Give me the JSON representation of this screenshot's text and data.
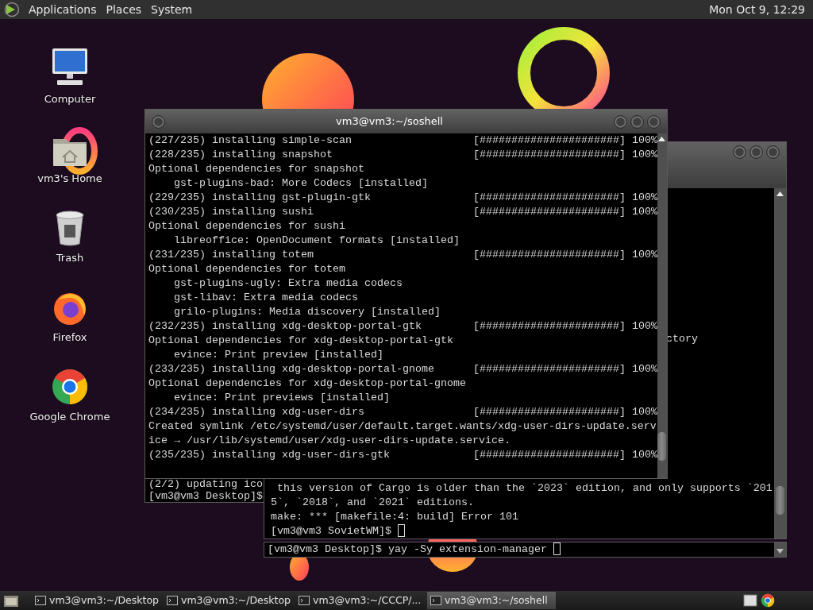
{
  "top_panel": {
    "menus": [
      {
        "label": "Applications"
      },
      {
        "label": "Places"
      },
      {
        "label": "System"
      }
    ],
    "clock": "Mon Oct 9, 12:29"
  },
  "desktop_icons": [
    {
      "kind": "computer",
      "label": "Computer"
    },
    {
      "kind": "home",
      "label": "vm3's Home"
    },
    {
      "kind": "trash",
      "label": "Trash"
    },
    {
      "kind": "firefox",
      "label": "Firefox"
    },
    {
      "kind": "chrome",
      "label": "Google Chrome"
    }
  ],
  "windows": [
    {
      "kind": "front_terminal",
      "title": "vm3@vm3:~/soshell",
      "lines": [
        {
          "text": "(227/235) installing simple-scan",
          "progress": "[######################] 100%"
        },
        {
          "text": "(228/235) installing snapshot",
          "progress": "[######################] 100%"
        },
        {
          "text": "Optional dependencies for snapshot"
        },
        {
          "text": "    gst-plugins-bad: More Codecs [installed]"
        },
        {
          "text": "(229/235) installing gst-plugin-gtk",
          "progress": "[######################] 100%"
        },
        {
          "text": "(230/235) installing sushi",
          "progress": "[######################] 100%"
        },
        {
          "text": "Optional dependencies for sushi"
        },
        {
          "text": "    libreoffice: OpenDocument formats [installed]"
        },
        {
          "text": "(231/235) installing totem",
          "progress": "[######################] 100%"
        },
        {
          "text": "Optional dependencies for totem"
        },
        {
          "text": "    gst-plugins-ugly: Extra media codecs"
        },
        {
          "text": "    gst-libav: Extra media codecs"
        },
        {
          "text": "    grilo-plugins: Media discovery [installed]"
        },
        {
          "text": "(232/235) installing xdg-desktop-portal-gtk",
          "progress": "[######################] 100%"
        },
        {
          "text": "Optional dependencies for xdg-desktop-portal-gtk"
        },
        {
          "text": "    evince: Print preview [installed]"
        },
        {
          "text": "(233/235) installing xdg-desktop-portal-gnome",
          "progress": "[######################] 100%"
        },
        {
          "text": "Optional dependencies for xdg-desktop-portal-gnome"
        },
        {
          "text": "    evince: Print previews [installed]"
        },
        {
          "text": "(234/235) installing xdg-user-dirs",
          "progress": "[######################] 100%"
        },
        {
          "text": "Created symlink /etc/systemd/user/default.target.wants/xdg-user-dirs-update.serv"
        },
        {
          "text": "ice → /usr/lib/systemd/user/xdg-user-dirs-update.service."
        },
        {
          "text": "(235/235) installing xdg-user-dirs-gtk",
          "progress": "[######################] 100%"
        }
      ]
    },
    {
      "kind": "middle_terminal",
      "lines": [
        {
          "kind": "fragment",
          "text": "ctory"
        },
        {
          "text": " this version of Cargo is older than the `2023` edition, and only supports `201"
        },
        {
          "text": "5`, `2018`, and `2021` editions."
        },
        {
          "text": "make: *** [makefile:4: build] Error 101"
        },
        {
          "text": "[vm3@vm3 SovietWM]$",
          "cursor": true
        }
      ]
    },
    {
      "kind": "left_terminal",
      "lines": [
        {
          "text": "(2/2) updating ico"
        },
        {
          "text": "[vm3@vm3 Desktop]$"
        }
      ]
    },
    {
      "kind": "bottom_terminal",
      "lines": [
        {
          "text": "[vm3@vm3 Desktop]$ yay -Sy extension-manager",
          "cursor": true
        }
      ]
    }
  ],
  "taskbar": {
    "tasks": [
      {
        "label": "vm3@vm3:~/Desktop",
        "selected": false
      },
      {
        "label": "vm3@vm3:~/Desktop",
        "selected": false
      },
      {
        "label": "vm3@vm3:~/CCCP/...",
        "selected": false
      },
      {
        "label": "vm3@vm3:~/soshell",
        "selected": true
      }
    ]
  }
}
